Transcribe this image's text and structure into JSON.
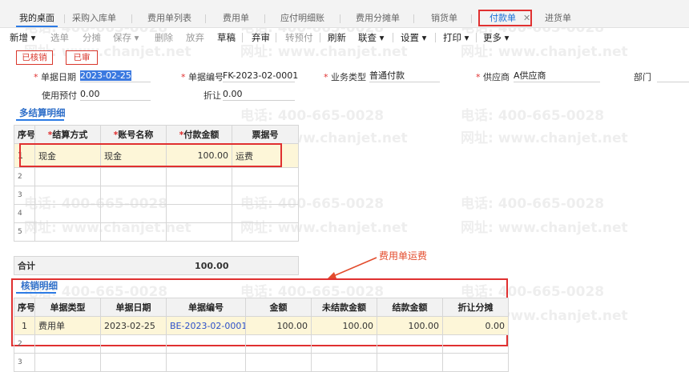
{
  "tabs": {
    "home": "我的桌面",
    "t1": "采购入库单",
    "t2": "费用单列表",
    "t3": "费用单",
    "t4": "应付明细账",
    "t5": "费用分摊单",
    "t6": "销货单",
    "active": "付款单",
    "close": "✕",
    "t8": "进货单"
  },
  "toolbar": {
    "new": "新增 ▾",
    "select": "选单",
    "split": "分摊",
    "save": "保存 ▾",
    "delete": "删除",
    "discard": "放弃",
    "draft": "草稿",
    "abandon": "弃审",
    "to_prepay": "转预付",
    "refresh": "刷新",
    "query": "联查 ▾",
    "settings": "设置 ▾",
    "print": "打印 ▾",
    "more": "更多 ▾"
  },
  "badges": {
    "writeoff": "已核销",
    "audited": "已审"
  },
  "form": {
    "date_label": "单据日期",
    "date_value": "2023-02-25",
    "code_label": "单据编号",
    "code_value": "FK-2023-02-0001",
    "biz_label": "业务类型",
    "biz_value": "普通付款",
    "supplier_label": "供应商",
    "supplier_value": "A供应商",
    "dept_label": "部门",
    "prepay_label": "使用预付",
    "prepay_value": "0.00",
    "discount_label": "折让",
    "discount_value": "0.00"
  },
  "settle": {
    "title": "多结算明细",
    "headers": {
      "seq": "序号",
      "method": "结算方式",
      "account": "账号名称",
      "amount": "付款金额",
      "ticket": "票据号"
    },
    "row": {
      "seq": "1",
      "method": "现金",
      "account": "现金",
      "amount": "100.00",
      "ticket": "运费"
    },
    "row_numbers": [
      "2",
      "3",
      "4",
      "5"
    ],
    "total_label": "合计",
    "total_value": "100.00"
  },
  "annotation": "费用单运费",
  "verify": {
    "title": "核销明细",
    "headers": {
      "seq": "序号",
      "type": "单据类型",
      "date": "单据日期",
      "code": "单据编号",
      "amount": "金额",
      "unpaid": "未结款金额",
      "paid": "结款金额",
      "discount": "折让分摊"
    },
    "row": {
      "seq": "1",
      "type": "费用单",
      "date": "2023-02-25",
      "code": "BE-2023-02-0001",
      "amount": "100.00",
      "unpaid": "100.00",
      "paid": "100.00",
      "discount": "0.00"
    },
    "row_numbers": [
      "2",
      "3"
    ]
  },
  "watermark": {
    "phone": "电话: 400-665-0028",
    "site": "网址: www.chanjet.net"
  },
  "colors": {
    "accent": "#2c7be5",
    "highlight": "#e03030",
    "row_bg": "#fdf6d8"
  }
}
